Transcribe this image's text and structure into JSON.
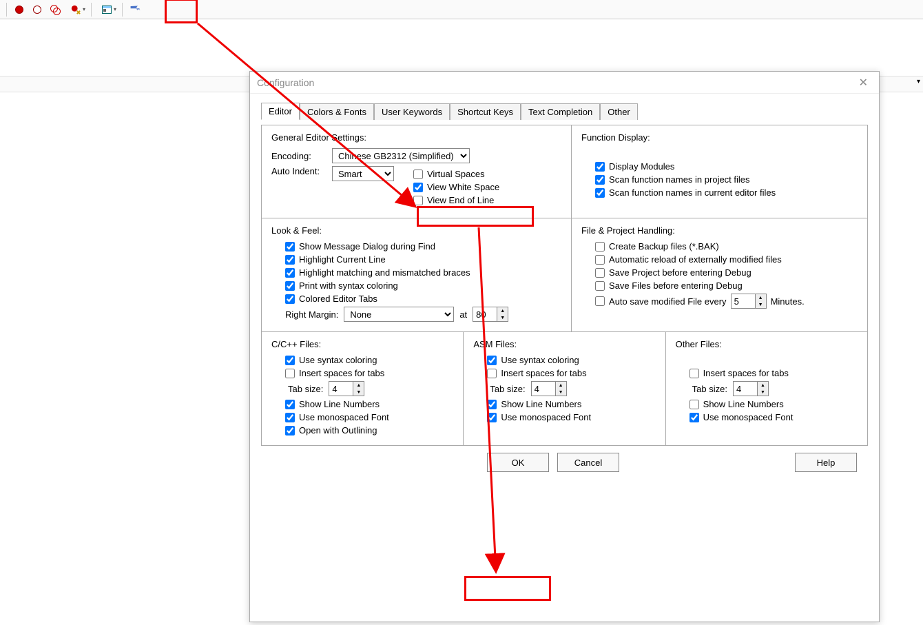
{
  "dialog": {
    "title": "Configuration",
    "tabs": [
      "Editor",
      "Colors & Fonts",
      "User Keywords",
      "Shortcut Keys",
      "Text Completion",
      "Other"
    ],
    "activeTab": "Editor",
    "buttons": {
      "ok": "OK",
      "cancel": "Cancel",
      "help": "Help"
    }
  },
  "general": {
    "header": "General Editor Settings:",
    "encodingLabel": "Encoding:",
    "encodingValue": "Chinese GB2312 (Simplified)",
    "autoIndentLabel": "Auto Indent:",
    "autoIndentValue": "Smart",
    "virtualSpaces": {
      "label": "Virtual Spaces",
      "checked": false
    },
    "viewWhiteSpace": {
      "label": "View White Space",
      "checked": true
    },
    "viewEOL": {
      "label": "View End of Line",
      "checked": false
    }
  },
  "funcDisplay": {
    "header": "Function Display:",
    "displayModules": {
      "label": "Display Modules",
      "checked": true
    },
    "scanProject": {
      "label": "Scan function names in project files",
      "checked": true
    },
    "scanEditor": {
      "label": "Scan function names in current editor files",
      "checked": true
    }
  },
  "lookFeel": {
    "header": "Look & Feel:",
    "msgDialog": {
      "label": "Show Message Dialog during Find",
      "checked": true
    },
    "hlLine": {
      "label": "Highlight Current Line",
      "checked": true
    },
    "hlBraces": {
      "label": "Highlight matching and mismatched braces",
      "checked": true
    },
    "printColor": {
      "label": "Print with syntax coloring",
      "checked": true
    },
    "colorTabs": {
      "label": "Colored Editor Tabs",
      "checked": true
    },
    "rightMarginLabel": "Right Margin:",
    "rightMarginValue": "None",
    "atLabel": "at",
    "atValue": "80"
  },
  "fileHandling": {
    "header": "File & Project Handling:",
    "backup": {
      "label": "Create Backup files (*.BAK)",
      "checked": false
    },
    "autoreload": {
      "label": "Automatic reload of externally modified files",
      "checked": false
    },
    "saveProj": {
      "label": "Save Project before entering Debug",
      "checked": false
    },
    "saveFiles": {
      "label": "Save Files before entering Debug",
      "checked": false
    },
    "autosave": {
      "labelPre": "Auto save modified File every",
      "value": "5",
      "labelPost": "Minutes.",
      "checked": false
    }
  },
  "cFiles": {
    "header": "C/C++ Files:",
    "syntax": {
      "label": "Use syntax coloring",
      "checked": true
    },
    "spaces": {
      "label": "Insert spaces for tabs",
      "checked": false
    },
    "tabLabel": "Tab size:",
    "tabValue": "4",
    "lineNums": {
      "label": "Show Line Numbers",
      "checked": true
    },
    "mono": {
      "label": "Use monospaced Font",
      "checked": true
    },
    "outline": {
      "label": "Open with Outlining",
      "checked": true
    }
  },
  "asmFiles": {
    "header": "ASM Files:",
    "syntax": {
      "label": "Use syntax coloring",
      "checked": true
    },
    "spaces": {
      "label": "Insert spaces for tabs",
      "checked": false
    },
    "tabLabel": "Tab size:",
    "tabValue": "4",
    "lineNums": {
      "label": "Show Line Numbers",
      "checked": true
    },
    "mono": {
      "label": "Use monospaced Font",
      "checked": true
    }
  },
  "otherFiles": {
    "header": "Other Files:",
    "spaces": {
      "label": "Insert spaces for tabs",
      "checked": false
    },
    "tabLabel": "Tab size:",
    "tabValue": "4",
    "lineNums": {
      "label": "Show Line Numbers",
      "checked": false
    },
    "mono": {
      "label": "Use monospaced Font",
      "checked": true
    }
  }
}
